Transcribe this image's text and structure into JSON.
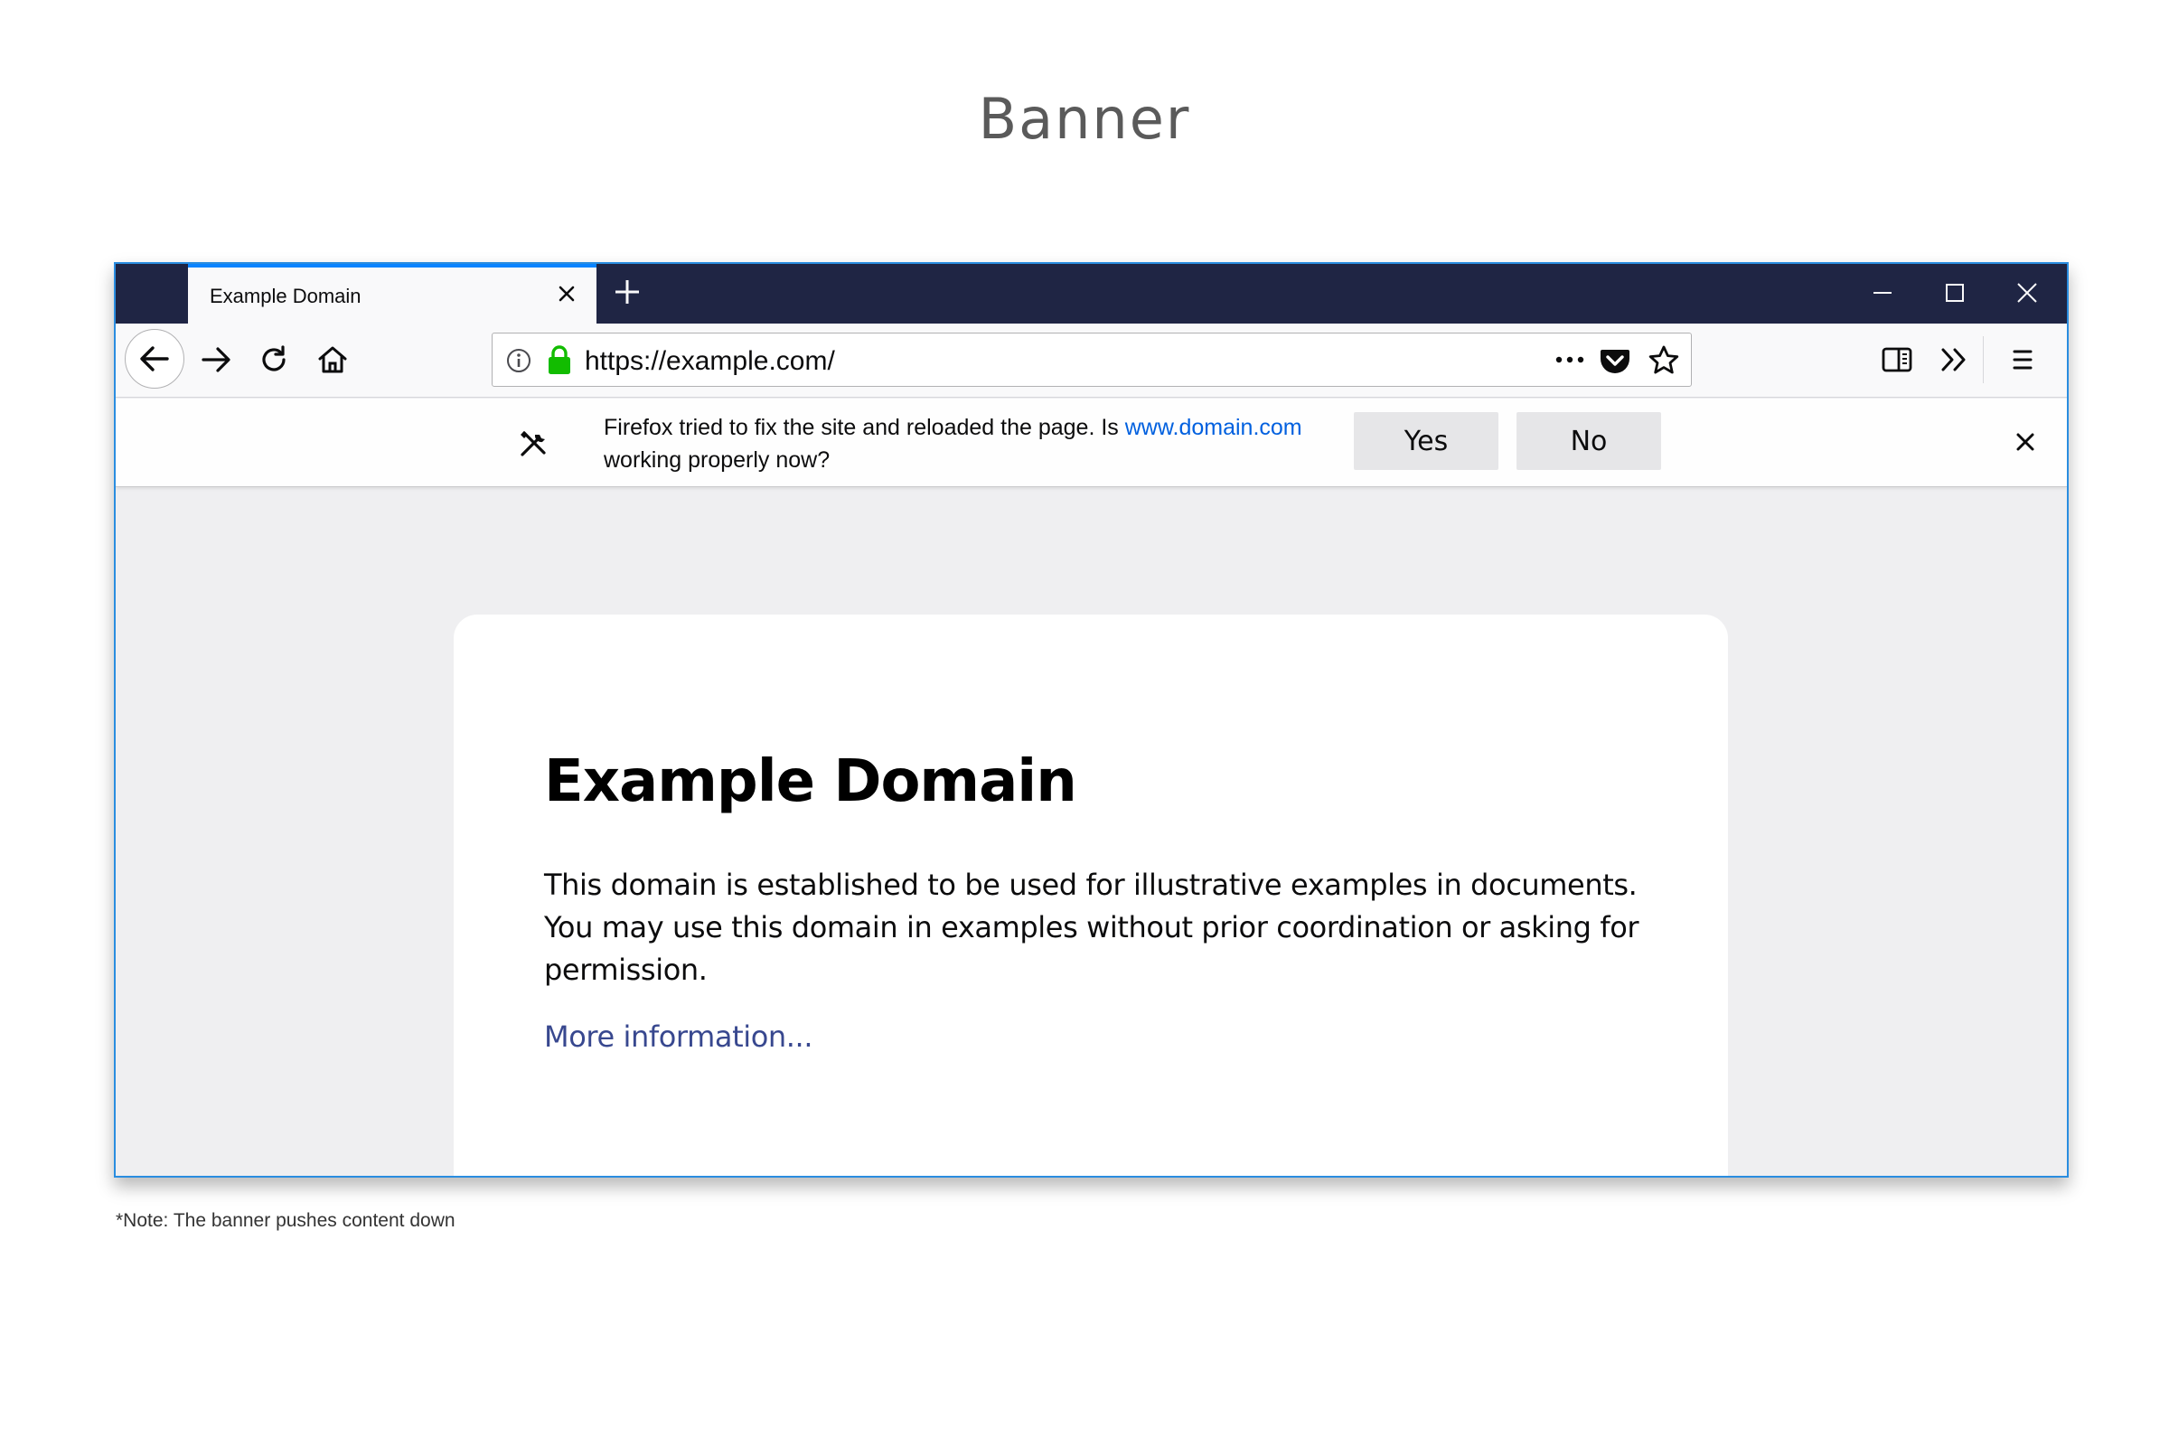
{
  "heading": "Banner",
  "tab": {
    "title": "Example Domain"
  },
  "urlbar": {
    "url": "https://example.com/"
  },
  "notification": {
    "text_before": "Firefox tried to fix the site and reloaded the page. Is ",
    "link": "www.domain.com",
    "text_after": " working properly now?",
    "yes_label": "Yes",
    "no_label": "No"
  },
  "page": {
    "title": "Example Domain",
    "body": "This domain is established to be used for illustrative examples in documents. You may use this domain in examples without prior coordination or asking for permission.",
    "link": "More information..."
  },
  "footnote": "*Note: The banner pushes content down",
  "colors": {
    "tabstrip": "#1f2544",
    "accent": "#0a84ff",
    "lock": "#12bc00",
    "link": "#0060df",
    "page_link": "#38488f"
  },
  "icons": [
    "close-icon",
    "plus-icon",
    "minimize-icon",
    "maximize-icon",
    "back-arrow-icon",
    "forward-arrow-icon",
    "reload-icon",
    "home-icon",
    "info-icon",
    "lock-icon",
    "more-dots-icon",
    "pocket-icon",
    "star-icon",
    "sidebar-icon",
    "overflow-chevron-icon",
    "hamburger-menu-icon",
    "tools-icon"
  ]
}
